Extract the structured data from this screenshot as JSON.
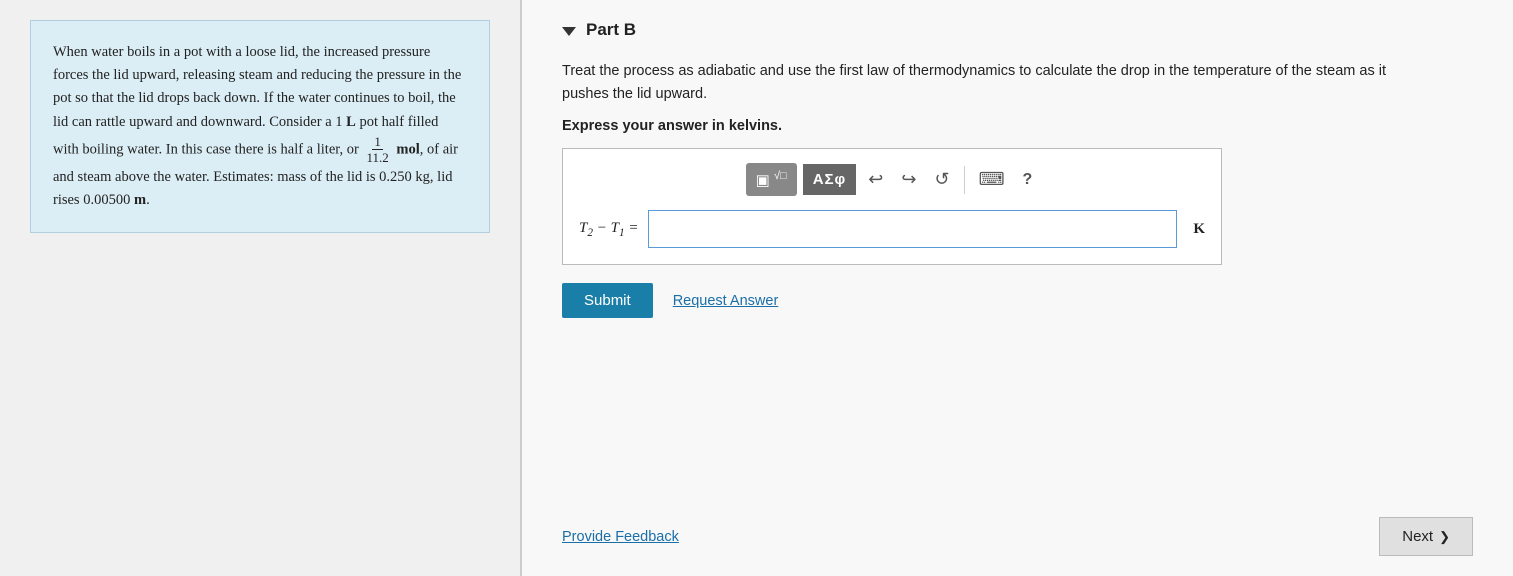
{
  "left": {
    "problem_text_lines": [
      "When water boils in a pot with a loose lid, the increased pressure forces the lid upward, releasing steam and reducing the pressure in the pot so that the lid drops back down. If the water continues to boil, the lid can rattle upward and downward. Consider a 1 L pot half filled with boiling water. In this case there is half a liter, or",
      "mol, of air and steam above the water. Estimates: mass of the lid is 0.250 kg, lid rises 0.00500 m."
    ],
    "fraction_num": "1",
    "fraction_den": "11.2",
    "unit_mol": "mol"
  },
  "right": {
    "part_label": "Part B",
    "question_text": "Treat the process as adiabatic and use the first law of thermodynamics to calculate the drop in the temperature of the steam as it pushes the lid upward.",
    "express_label": "Express your answer in kelvins.",
    "equation_label": "T₂ − T₁ =",
    "unit": "K",
    "toolbar": {
      "template_icon": "▣",
      "radical_icon": "√□",
      "greek_label": "ΑΣφ",
      "undo_label": "↩",
      "redo_label": "↪",
      "refresh_label": "↺",
      "keyboard_label": "⌨",
      "help_label": "?"
    },
    "buttons": {
      "submit": "Submit",
      "request_answer": "Request Answer",
      "provide_feedback": "Provide Feedback",
      "next": "Next"
    }
  }
}
